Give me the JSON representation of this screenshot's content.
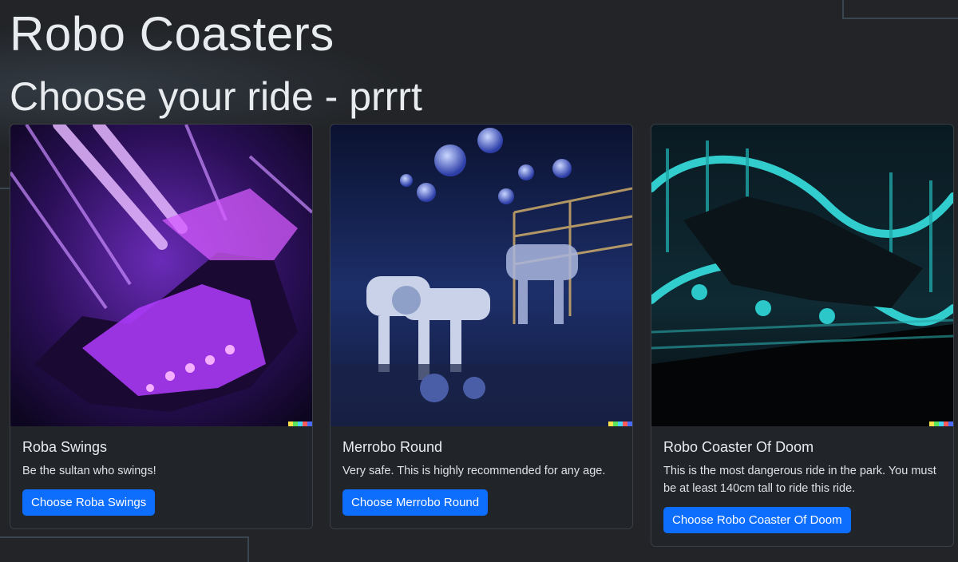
{
  "page": {
    "title": "Robo Coasters",
    "subtitle": "Choose your ride - prrrt"
  },
  "rides": [
    {
      "name": "Roba Swings",
      "description": "Be the sultan who swings!",
      "button_label": "Choose Roba Swings",
      "image_theme": "purple-neon-swing-ride"
    },
    {
      "name": "Merrobo Round",
      "description": "Very safe. This is highly recommended for any age.",
      "button_label": "Choose Merrobo Round",
      "image_theme": "robot-horse-carousel"
    },
    {
      "name": "Robo Coaster Of Doom",
      "description": "This is the most dangerous ride in the park. You must be at least 140cm tall to ride this ride.",
      "button_label": "Choose Robo Coaster Of Doom",
      "image_theme": "cyan-neon-rollercoaster"
    }
  ],
  "colors": {
    "background": "#222427",
    "card": "#212529",
    "button": "#0d6efd",
    "swing_accent": "#b03cff",
    "carousel_accent": "#5a7bd8",
    "coaster_accent": "#2fd6d6"
  }
}
